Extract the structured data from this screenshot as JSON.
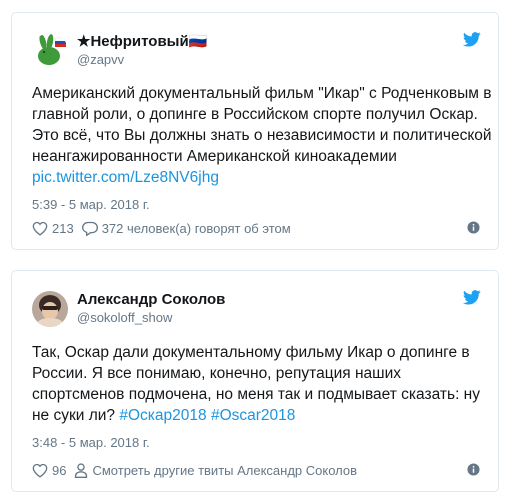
{
  "tweets": [
    {
      "author_name": "★Нефритовый🇷🇺",
      "handle": "@zapvv",
      "text": "Американский документальный фильм \"Икар\" с Родченковым в главной роли, о допинге в Российском спорте получил Оскар. Это всё, что Вы должны знать о независимости и политической неангажированности Американской киноакадемии ",
      "link": "pic.twitter.com/Lze8NV6jhg",
      "time": "5:39 - 5 мар. 2018 г.",
      "likes": "213",
      "replies_text": "372 человек(а) говорят об этом",
      "avatar_icon": "rabbit-flag-avatar"
    },
    {
      "author_name": "Александр Соколов",
      "handle": "@sokoloff_show",
      "text": "Так, Оскар дали документальному фильму Икар о допинге в России. Я все понимаю, конечно, репутация наших спортсменов подмочена, но меня так и подмывает сказать: ну не суки ли? ",
      "hashtag1": "#Оскар2018",
      "hashtag2": "#Oscar2018",
      "time": "3:48 - 5 мар. 2018 г.",
      "likes": "96",
      "more_text": "Смотреть другие твиты Александр Соколов",
      "avatar_icon": "photo-avatar"
    }
  ],
  "colors": {
    "link": "#1b95e0",
    "secondary_text": "#657786",
    "border": "#e1e8ed",
    "twitter_blue": "#1da1f2"
  }
}
